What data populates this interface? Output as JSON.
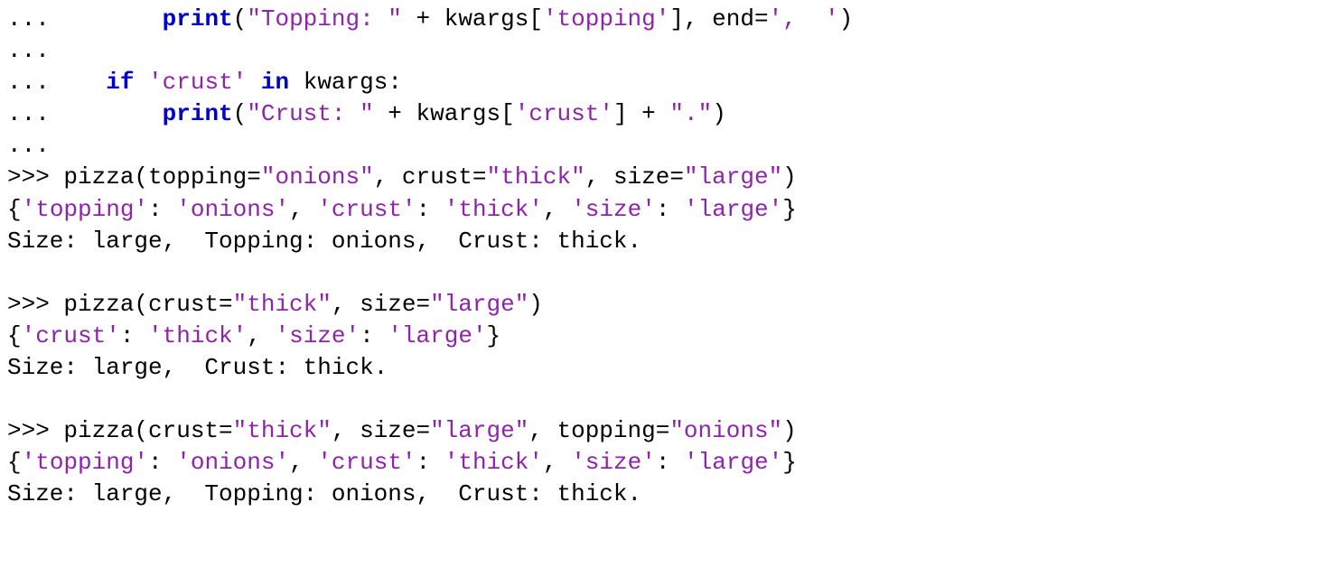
{
  "lines": {
    "l1_dots": "...",
    "l1_print": "print",
    "l1_open": "(",
    "l1_s1": "\"Topping: \"",
    "l1_plus": " + kwargs[",
    "l1_s2": "'topping'",
    "l1_after": "], end=",
    "l1_s3": "',  '",
    "l1_close": ")",
    "l2_dots": "...",
    "l3_dots": "...",
    "l3_if": "if",
    "l3_s1": " 'crust' ",
    "l3_in": "in",
    "l3_rest": " kwargs:",
    "l4_dots": "...",
    "l4_print": "print",
    "l4_open": "(",
    "l4_s1": "\"Crust: \"",
    "l4_plus": " + kwargs[",
    "l4_s2": "'crust'",
    "l4_plus2": "] + ",
    "l4_s3": "\".\"",
    "l4_close": ")",
    "l5_dots": "...",
    "l6_prompt": ">>> pizza(topping=",
    "l6_s1": "\"onions\"",
    "l6_mid1": ", crust=",
    "l6_s2": "\"thick\"",
    "l6_mid2": ", size=",
    "l6_s3": "\"large\"",
    "l6_close": ")",
    "l7_open": "{",
    "l7_k1": "'topping'",
    "l7_c1": ": ",
    "l7_v1": "'onions'",
    "l7_c2": ", ",
    "l7_k2": "'crust'",
    "l7_c3": ": ",
    "l7_v2": "'thick'",
    "l7_c4": ", ",
    "l7_k3": "'size'",
    "l7_c5": ": ",
    "l7_v3": "'large'",
    "l7_close": "}",
    "l8": "Size: large,  Topping: onions,  Crust: thick.",
    "l9": "",
    "l10_prompt": ">>> pizza(crust=",
    "l10_s1": "\"thick\"",
    "l10_mid": ", size=",
    "l10_s2": "\"large\"",
    "l10_close": ")",
    "l11_open": "{",
    "l11_k1": "'crust'",
    "l11_c1": ": ",
    "l11_v1": "'thick'",
    "l11_c2": ", ",
    "l11_k2": "'size'",
    "l11_c3": ": ",
    "l11_v2": "'large'",
    "l11_close": "}",
    "l12": "Size: large,  Crust: thick.",
    "l13": "",
    "l14_prompt": ">>> pizza(crust=",
    "l14_s1": "\"thick\"",
    "l14_mid1": ", size=",
    "l14_s2": "\"large\"",
    "l14_mid2": ", topping=",
    "l14_s3": "\"onions\"",
    "l14_close": ")",
    "l15_open": "{",
    "l15_k1": "'topping'",
    "l15_c1": ": ",
    "l15_v1": "'onions'",
    "l15_c2": ", ",
    "l15_k2": "'crust'",
    "l15_c3": ": ",
    "l15_v2": "'thick'",
    "l15_c4": ", ",
    "l15_k3": "'size'",
    "l15_c5": ": ",
    "l15_v3": "'large'",
    "l15_close": "}",
    "l16": "Size: large,  Topping: onions,  Crust: thick."
  }
}
